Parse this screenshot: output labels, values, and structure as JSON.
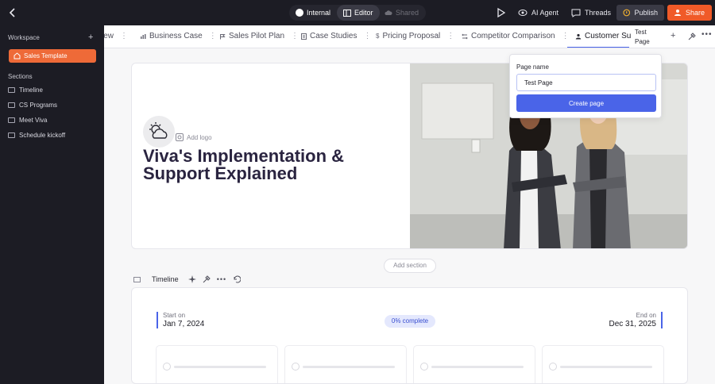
{
  "topbar": {
    "modes": [
      "Internal",
      "Editor",
      "Shared"
    ],
    "ai_agent": "AI Agent",
    "threads": "Threads",
    "publish": "Publish",
    "share": "Share",
    "accent_color": "#f05a28"
  },
  "sidebar": {
    "workspace": "Workspace",
    "template": "Sales Template",
    "sections_label": "Sections",
    "items": [
      "Timeline",
      "CS Programs",
      "Meet Viva",
      "Schedule kickoff"
    ]
  },
  "tabs": {
    "items": [
      {
        "label": "view"
      },
      {
        "label": "Business Case"
      },
      {
        "label": "Sales Pilot Plan"
      },
      {
        "label": "Case Studies"
      },
      {
        "label": "Pricing Proposal"
      },
      {
        "label": "Competitor Comparison"
      },
      {
        "label": "Customer Su"
      }
    ],
    "new_page_line1": "Test",
    "new_page_line2": "Page"
  },
  "hero": {
    "add_logo": "Add logo",
    "title": "Viva's Implementation & Support Explained"
  },
  "add_section": "Add section",
  "timeline": {
    "title": "Timeline",
    "start_label": "Start on",
    "start_date": "Jan 7, 2024",
    "end_label": "End on",
    "end_date": "Dec 31, 2025",
    "progress": "0% complete"
  },
  "popover": {
    "label": "Page name",
    "value": "Test Page",
    "button": "Create page"
  }
}
